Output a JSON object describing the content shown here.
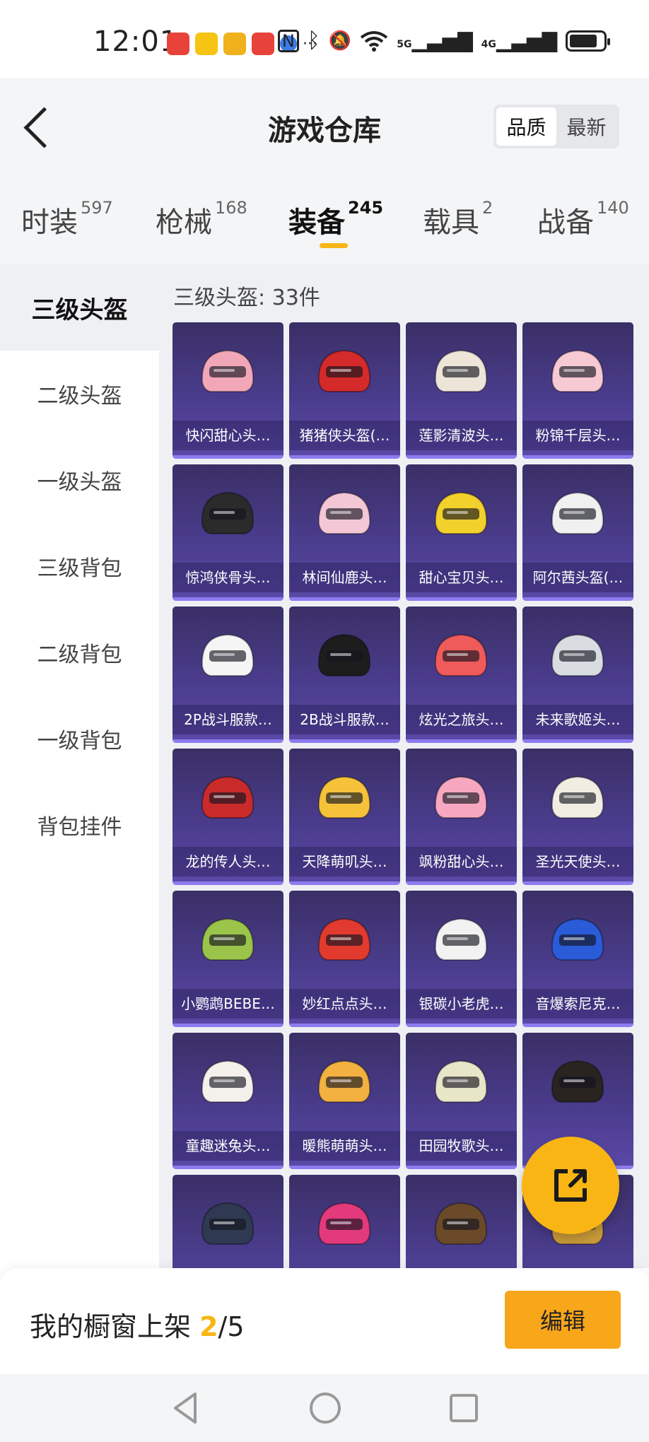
{
  "status_bar": {
    "time": "12:01",
    "icons": [
      "huawei-store-icon",
      "game-center-icon",
      "camera-app-icon",
      "huawei-icon",
      "browser-icon",
      "more-dots-icon",
      "nfc-icon",
      "bluetooth-icon",
      "mute-icon",
      "wifi-icon",
      "signal-5g-icon",
      "signal-4g-icon",
      "battery-icon"
    ],
    "network1": "5G",
    "network2": "4G"
  },
  "header": {
    "title": "游戏仓库",
    "sort_options": [
      "品质",
      "最新"
    ],
    "sort_active": "品质"
  },
  "tabs": [
    {
      "label": "时装",
      "count": "597"
    },
    {
      "label": "枪械",
      "count": "168"
    },
    {
      "label": "装备",
      "count": "245"
    },
    {
      "label": "载具",
      "count": "2"
    },
    {
      "label": "战备",
      "count": "140"
    }
  ],
  "tab_active": "装备",
  "sidebar": {
    "items": [
      "三级头盔",
      "二级头盔",
      "一级头盔",
      "三级背包",
      "二级背包",
      "一级背包",
      "背包挂件"
    ],
    "active": "三级头盔"
  },
  "section": {
    "heading": "三级头盔: 33件"
  },
  "items": [
    {
      "name": "快闪甜心头…",
      "color": "#f2a7b8"
    },
    {
      "name": "猪猪侠头盔(…",
      "color": "#d42a2a"
    },
    {
      "name": "莲影清波头…",
      "color": "#ece5d8"
    },
    {
      "name": "粉锦千层头…",
      "color": "#f7c9d2"
    },
    {
      "name": "惊鸿侠骨头…",
      "color": "#2b2b2b"
    },
    {
      "name": "林间仙鹿头…",
      "color": "#f4c7d6"
    },
    {
      "name": "甜心宝贝头…",
      "color": "#f3d12c"
    },
    {
      "name": "阿尔茜头盔(…",
      "color": "#f0f0f0"
    },
    {
      "name": "2P战斗服款…",
      "color": "#f5f5f5"
    },
    {
      "name": "2B战斗服款…",
      "color": "#1d1d1d"
    },
    {
      "name": "炫光之旅头…",
      "color": "#ef5b5b"
    },
    {
      "name": "未来歌姬头…",
      "color": "#d9dde2"
    },
    {
      "name": "龙的传人头…",
      "color": "#c92b2b"
    },
    {
      "name": "天降萌叽头…",
      "color": "#f5c23a"
    },
    {
      "name": "飒粉甜心头…",
      "color": "#f7a8c0"
    },
    {
      "name": "圣光天使头…",
      "color": "#f1ede2"
    },
    {
      "name": "小鹦鹉BEBE…",
      "color": "#9bc44a"
    },
    {
      "name": "妙红点点头…",
      "color": "#e23a2e"
    },
    {
      "name": "银碳小老虎…",
      "color": "#f2f2f2"
    },
    {
      "name": "音爆索尼克…",
      "color": "#2a5bd8"
    },
    {
      "name": "童趣迷兔头…",
      "color": "#f4f1ec"
    },
    {
      "name": "暖熊萌萌头…",
      "color": "#f2b140"
    },
    {
      "name": "田园牧歌头…",
      "color": "#e8e6c8"
    },
    {
      "name": "",
      "color": "#2a2420"
    },
    {
      "name": "",
      "color": "#2f3a52"
    },
    {
      "name": "",
      "color": "#e23a7a"
    },
    {
      "name": "",
      "color": "#6b4a2a"
    },
    {
      "name": "",
      "color": "#c99a3a"
    }
  ],
  "bottom_bar": {
    "prefix": "我的橱窗上架 ",
    "count": "2",
    "suffix": "/5",
    "edit_label": "编辑"
  },
  "accent_color": "#f8b514"
}
